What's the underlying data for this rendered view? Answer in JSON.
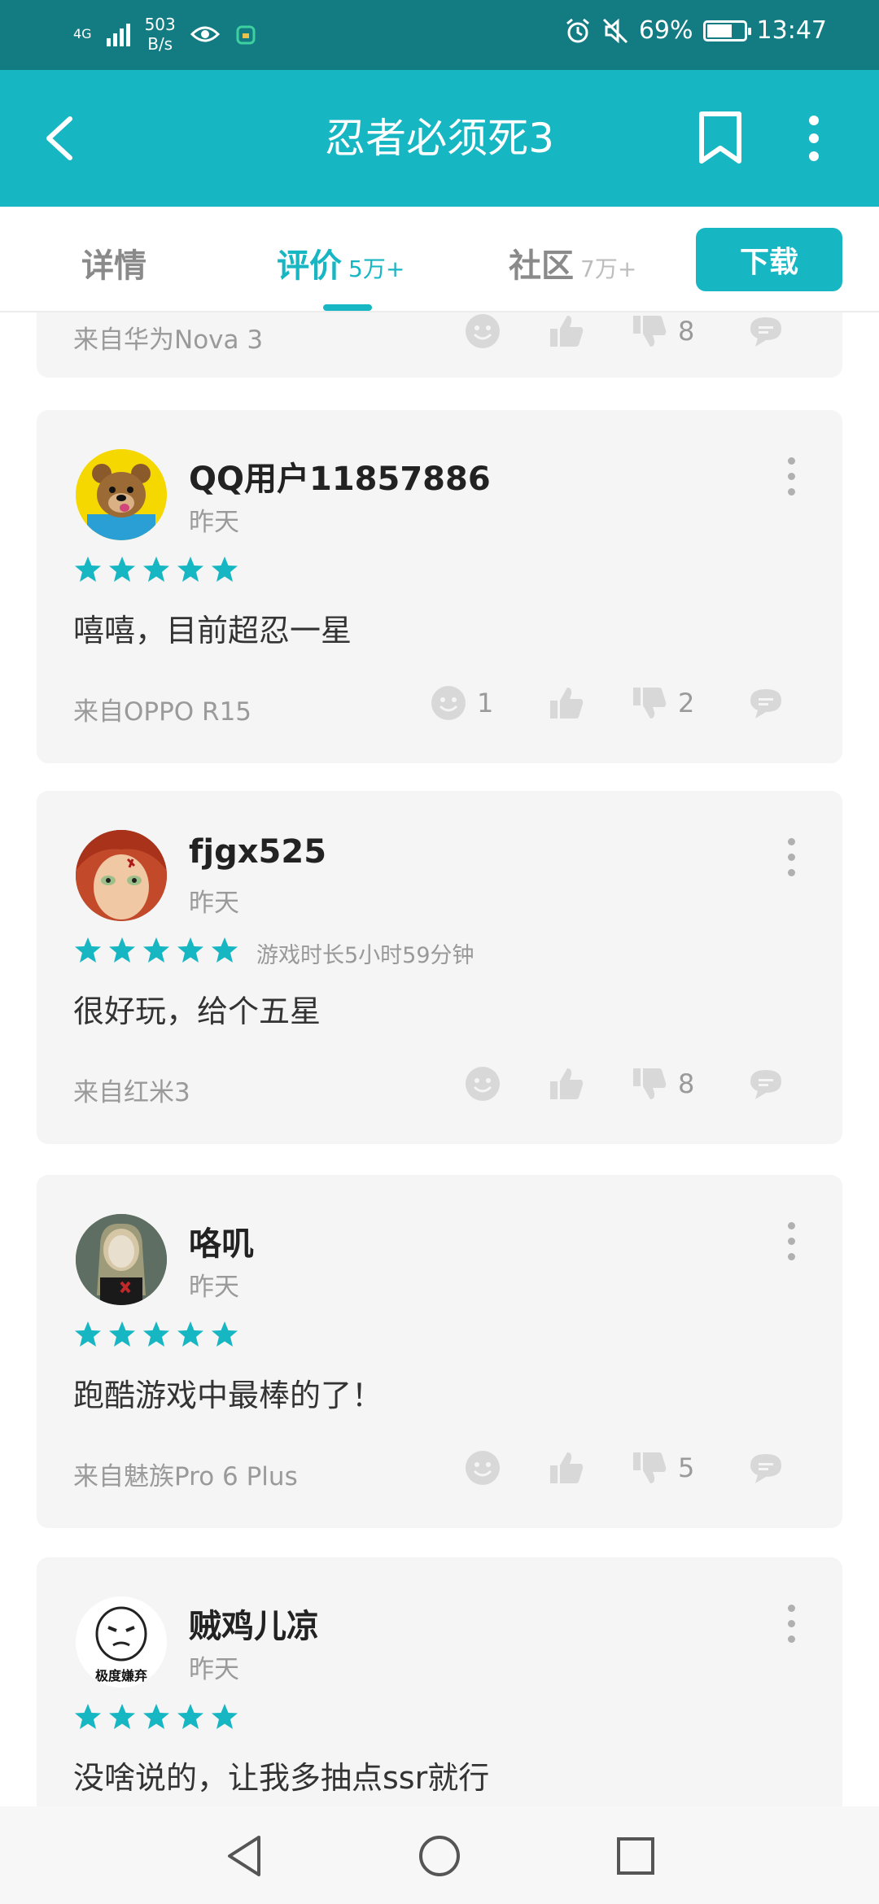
{
  "status_bar": {
    "network": "4G",
    "speed_value": "503",
    "speed_unit": "B/s",
    "battery": "69%",
    "battery_level": 0.69,
    "time": "13:47"
  },
  "app_bar": {
    "title": "忍者必须死3"
  },
  "tabs": [
    {
      "label": "详情",
      "count": ""
    },
    {
      "label": "评价",
      "count": "5万+"
    },
    {
      "label": "社区",
      "count": "7万+"
    }
  ],
  "download_label": "下载",
  "partial_review": {
    "device": "来自华为Nova 3",
    "funny": "",
    "likes": "",
    "dislikes": "8"
  },
  "reviews": [
    {
      "username": "QQ用户11857886",
      "date": "昨天",
      "rating": 5,
      "playtime": "",
      "text": "嘻嘻，目前超忍一星",
      "device": "来自OPPO R15",
      "funny": "1",
      "likes": "",
      "dislikes": "2"
    },
    {
      "username": "fjgx525",
      "date": "昨天",
      "rating": 5,
      "playtime": "游戏时长5小时59分钟",
      "text": "很好玩，给个五星",
      "device": "来自红米3",
      "funny": "",
      "likes": "",
      "dislikes": "8"
    },
    {
      "username": "咯叽",
      "date": "昨天",
      "rating": 5,
      "playtime": "",
      "text": "跑酷游戏中最棒的了！",
      "device": "来自魅族Pro 6 Plus",
      "funny": "",
      "likes": "",
      "dislikes": "5"
    },
    {
      "username": "贼鸡儿凉",
      "date": "昨天",
      "rating": 5,
      "playtime": "",
      "text": "没啥说的，让我多抽点ssr就行",
      "avatar_caption": "极度嫌弃"
    }
  ],
  "colors": {
    "accent": "#17b6c3",
    "status_bar": "#137c82",
    "card_bg": "#f5f5f5"
  }
}
